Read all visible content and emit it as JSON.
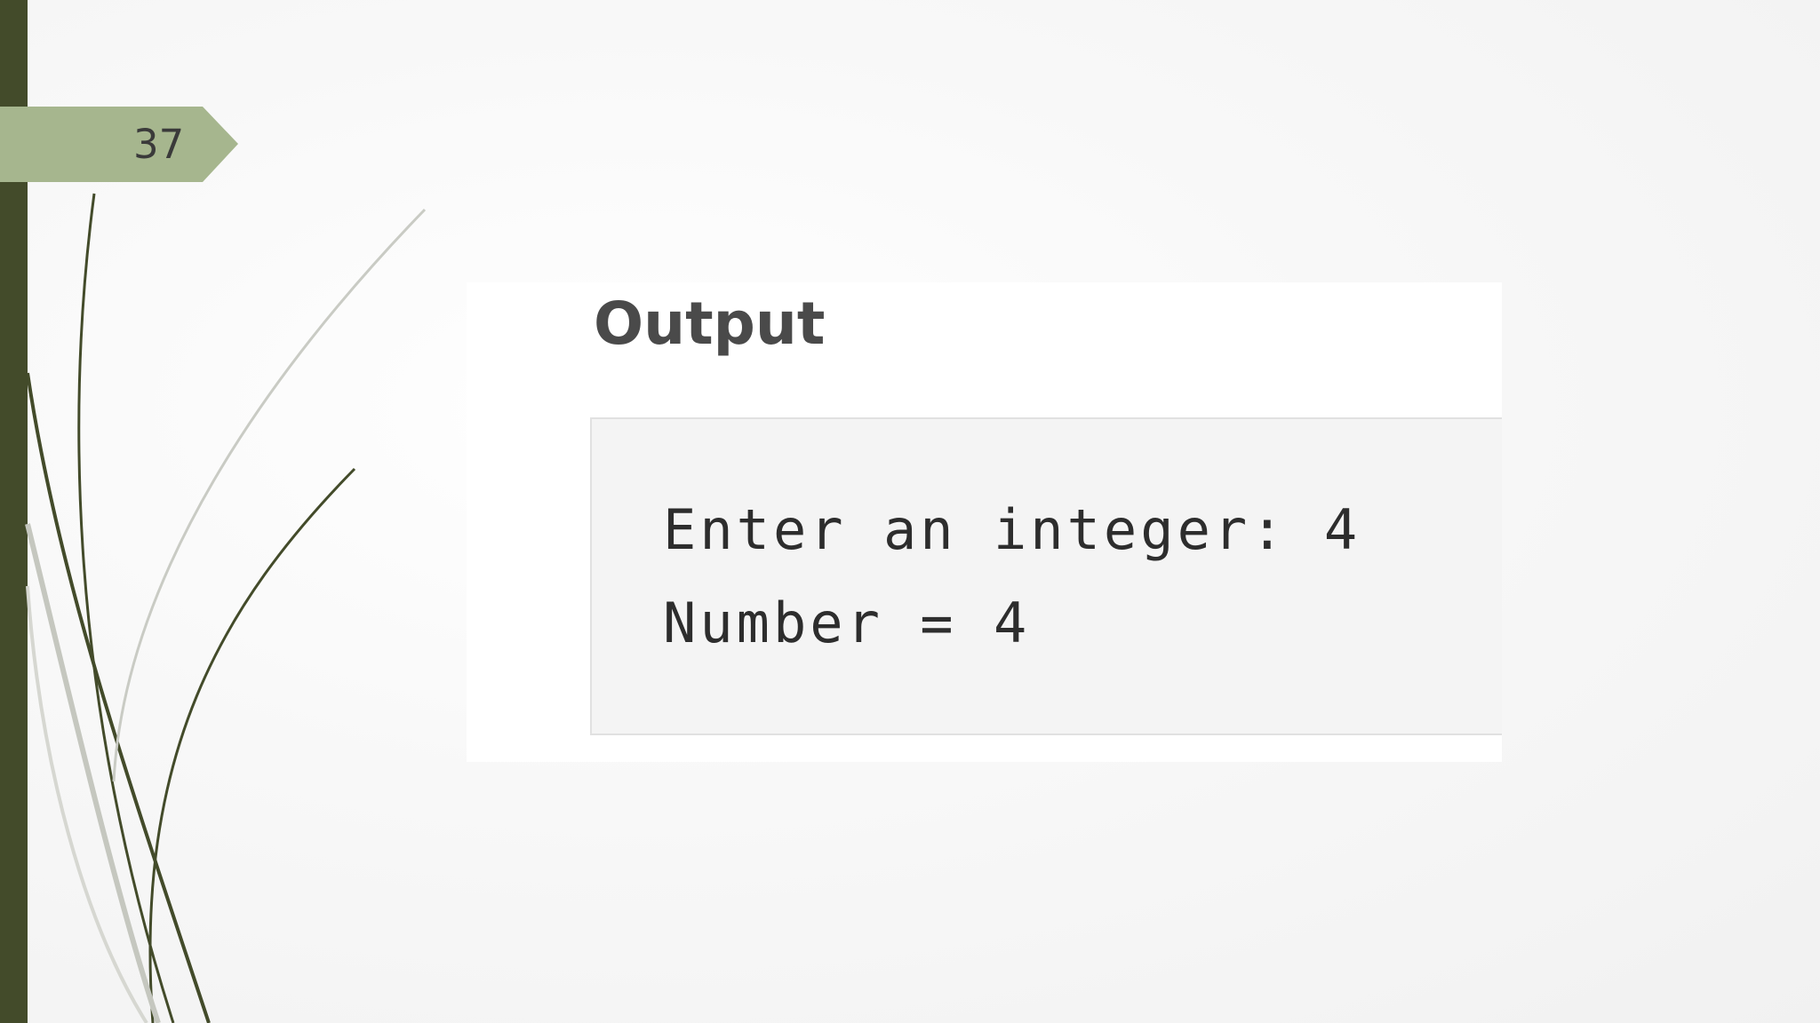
{
  "slide": {
    "page_number": "37"
  },
  "output_image": {
    "heading": "Output",
    "console_lines": [
      "Enter an integer: 4",
      "Number = 4"
    ]
  },
  "colors": {
    "accent_dark": "#434b2a",
    "tab_green": "#a6b68e",
    "code_background": "#f4f4f4"
  }
}
